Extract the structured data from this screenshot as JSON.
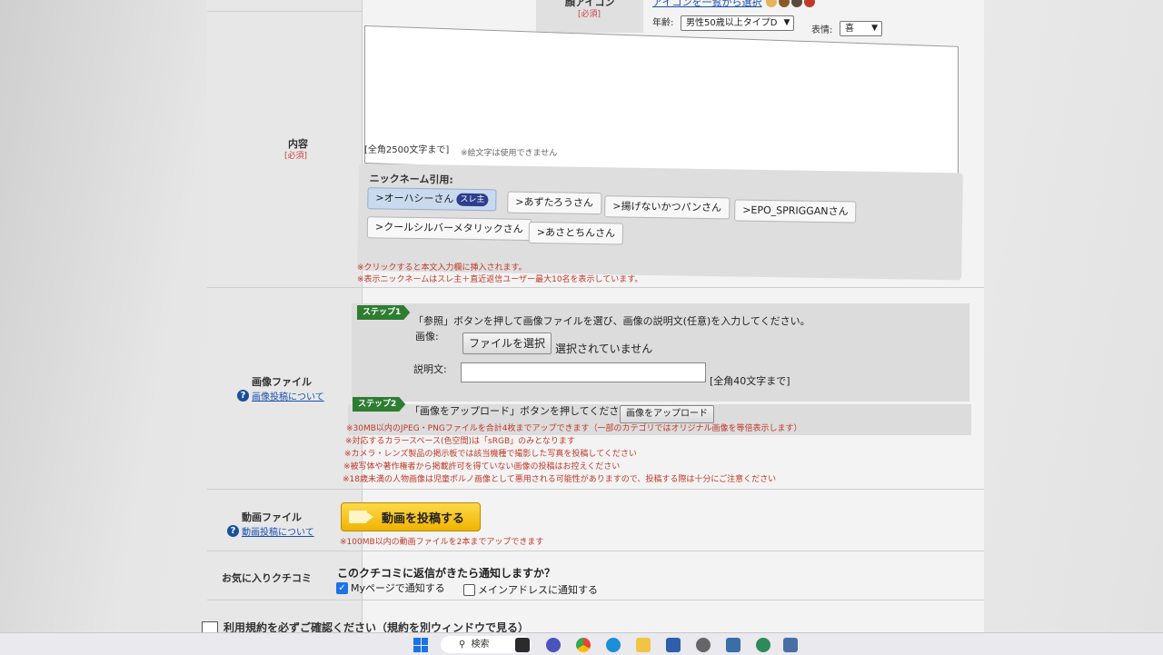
{
  "face_icon": {
    "label": "顔アイコン",
    "required": "[必須]",
    "link": "アイコンを一覧から選択"
  },
  "age": {
    "label": "年齢:",
    "value": "男性50歳以上タイプD"
  },
  "expression": {
    "label": "表情:",
    "value": "喜"
  },
  "content": {
    "label": "内容",
    "required": "[必須]",
    "limit": "[全角2500文字まで]",
    "emoji_note": "※絵文字は使用できません"
  },
  "nickname": {
    "title": "ニックネーム引用:",
    "chips": [
      ">オーハシーさん",
      ">あずたろうさん",
      ">揚げないかつパンさん",
      ">EPO_SPRIGGANさん",
      ">クールシルバーメタリックさん",
      ">あさとちんさん"
    ],
    "badge": "スレ主",
    "notes": [
      "※クリックすると本文入力欄に挿入されます。",
      "※表示ニックネームはスレ主＋直近返信ユーザー最大10名を表示しています。"
    ]
  },
  "image": {
    "label": "画像ファイル",
    "help": "画像投稿について",
    "step1": "ステップ1",
    "step1_text": "「参照」ボタンを押して画像ファイルを選び、画像の説明文(任意)を入力してください。",
    "image_label": "画像:",
    "file_button": "ファイルを選択",
    "file_status": "選択されていません",
    "desc_label": "説明文:",
    "desc_limit": "[全角40文字まで]",
    "step2": "ステップ2",
    "step2_text": "「画像をアップロード」ボタンを押してください。",
    "upload_button": "画像をアップロード",
    "notes": [
      "※30MB以内のJPEG・PNGファイルを合計4枚までアップできます（一部のカテゴリではオリジナル画像を等倍表示します）",
      "※対応するカラースペース(色空間)は「sRGB」のみとなります",
      "※カメラ・レンズ製品の掲示板では該当機種で撮影した写真を投稿してください",
      "※被写体や著作権者から掲載許可を得ていない画像の投稿はお控えください",
      "※18歳未満の人物画像は児童ポルノ画像として悪用される可能性がありますので、投稿する際は十分にご注意ください"
    ]
  },
  "video": {
    "label": "動画ファイル",
    "help": "動画投稿について",
    "button": "動画を投稿する",
    "note": "※100MB以内の動画ファイルを2本までアップできます"
  },
  "favorite": {
    "label": "お気に入りクチコミ",
    "question": "このクチコミに返信がきたら通知しますか？",
    "option1": "Myページで通知する",
    "option1_checked": true,
    "option2": "メインアドレスに通知する",
    "option2_checked": false
  },
  "terms": "利用規約を必ずご確認ください（規約を別ウィンドウで見る）",
  "taskbar": {
    "search": "検索"
  }
}
